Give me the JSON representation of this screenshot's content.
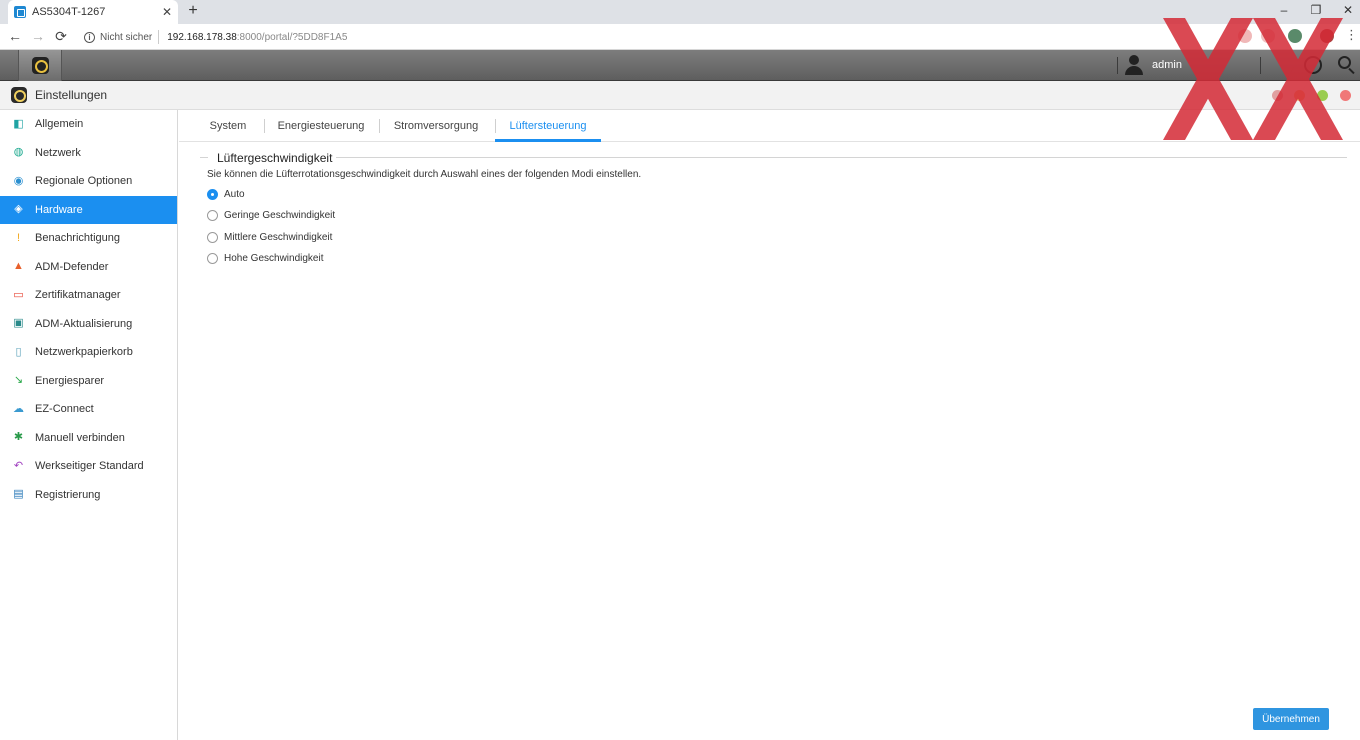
{
  "browser": {
    "tab_title": "AS5304T-1267",
    "tab_close": "✕",
    "new_tab": "+",
    "win_minimize": "–",
    "win_restore": "❐",
    "win_close": "✕",
    "back": "←",
    "forward": "→",
    "reload": "⟳",
    "insecure_label": "Nicht sicher",
    "url_host": "192.168.178.38",
    "url_path": ":8000/portal/?5DD8F1A5",
    "menu": "⋮"
  },
  "taskbar": {
    "user_name": "admin"
  },
  "app": {
    "title": "Einstellungen"
  },
  "sidebar": {
    "items": [
      {
        "label": "Allgemein",
        "icon": "general-icon",
        "color": "#1fa3a3"
      },
      {
        "label": "Netzwerk",
        "icon": "globe-icon",
        "color": "#1aa88e"
      },
      {
        "label": "Regionale Optionen",
        "icon": "region-icon",
        "color": "#2a8fd0"
      },
      {
        "label": "Hardware",
        "icon": "hardware-icon",
        "color": "#ffffff",
        "active": true
      },
      {
        "label": "Benachrichtigung",
        "icon": "notification-icon",
        "color": "#f2a81d"
      },
      {
        "label": "ADM-Defender",
        "icon": "defender-icon",
        "color": "#e8602c"
      },
      {
        "label": "Zertifikatmanager",
        "icon": "certificate-icon",
        "color": "#e84a3a"
      },
      {
        "label": "ADM-Aktualisierung",
        "icon": "update-icon",
        "color": "#2a8a8a"
      },
      {
        "label": "Netzwerkpapierkorb",
        "icon": "recycle-bin-icon",
        "color": "#5aa0b8"
      },
      {
        "label": "Energiesparer",
        "icon": "energy-saver-icon",
        "color": "#2aa84a"
      },
      {
        "label": "EZ-Connect",
        "icon": "cloud-icon",
        "color": "#3a9ad0"
      },
      {
        "label": "Manuell verbinden",
        "icon": "connect-icon",
        "color": "#2a9a4a"
      },
      {
        "label": "Werkseitiger Standard",
        "icon": "reset-icon",
        "color": "#a040c0"
      },
      {
        "label": "Registrierung",
        "icon": "registration-icon",
        "color": "#2a7ab8"
      }
    ]
  },
  "tabs": [
    {
      "label": "System"
    },
    {
      "label": "Energiesteuerung"
    },
    {
      "label": "Stromversorgung"
    },
    {
      "label": "Lüftersteuerung",
      "active": true
    }
  ],
  "fan": {
    "section_title": "Lüftergeschwindigkeit",
    "description": "Sie können die Lüfterrotationsgeschwindigkeit durch Auswahl eines der folgenden Modi einstellen.",
    "options": [
      {
        "label": "Auto",
        "checked": true
      },
      {
        "label": "Geringe Geschwindigkeit",
        "checked": false
      },
      {
        "label": "Mittlere Geschwindigkeit",
        "checked": false
      },
      {
        "label": "Hohe Geschwindigkeit",
        "checked": false
      }
    ],
    "selected": "Auto"
  },
  "apply_label": "Übernehmen",
  "colors": {
    "accent": "#1b8ff0",
    "button": "#2f95e0",
    "watermark": "#d42a36"
  }
}
